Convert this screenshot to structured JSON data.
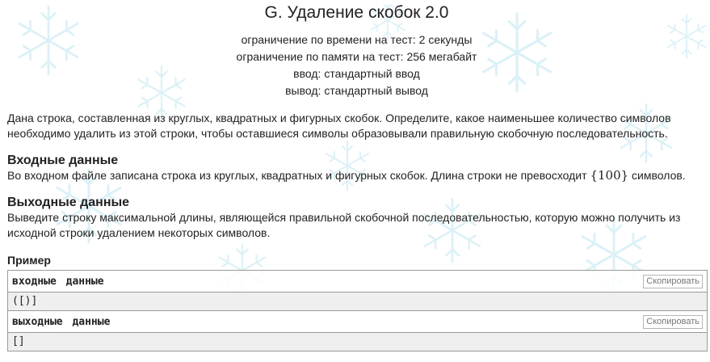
{
  "problem": {
    "title": "G. Удаление скобок 2.0",
    "limits": [
      "ограничение по времени на тест: 2 секунды",
      "ограничение по памяти на тест: 256 мегабайт",
      "ввод: стандартный ввод",
      "вывод: стандартный вывод"
    ],
    "statement_lines": [
      "Дана строка, составленная из круглых, квадратных и фигурных скобок. Определите, какое наименьшее количество символов",
      "необходимо удалить из этой строки, чтобы оставшиеся символы образовывали правильную скобочную последовательность."
    ],
    "input": {
      "title": "Входные данные",
      "text_before": "Во входном файле записана строка из круглых, квадратных и фигурных скобок. Длина строки не превосходит ",
      "math": "{100}",
      "text_after": " символов."
    },
    "output": {
      "title": "Выходные данные",
      "lines": [
        "Выведите строку максимальной длины, являющейся правильной скобочной последовательностью, которую можно получить из",
        "исходной строки удалением некоторых символов."
      ]
    },
    "example": {
      "label": "Пример",
      "input_title": "входные данные",
      "input_value": "([)]",
      "output_title": "выходные данные",
      "output_value": "[]",
      "copy_label": "Скопировать"
    }
  },
  "colors": {
    "background_flakes": "#dff3f8",
    "border": "#9a9a9a",
    "sample_body_bg": "#efefef"
  },
  "icons": [
    "snowflake-icon"
  ]
}
